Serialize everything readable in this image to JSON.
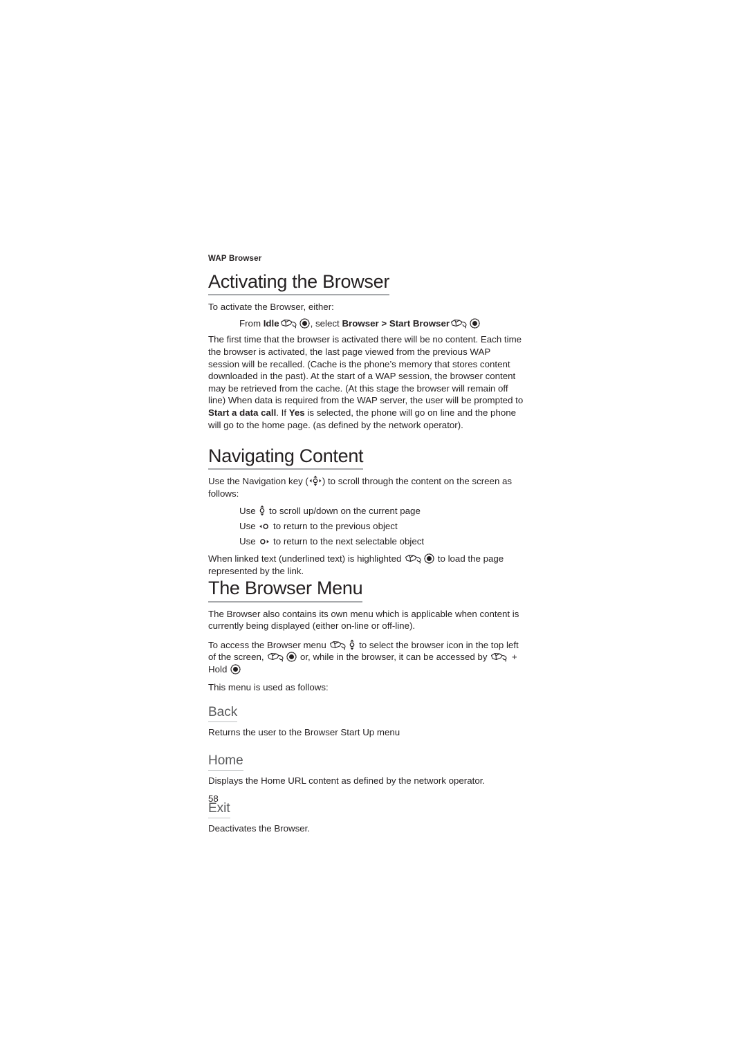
{
  "page": {
    "running_head": "WAP Browser",
    "folio": "58",
    "accent_rule_color": "#a7a9ac",
    "heading_color": "#231f20",
    "subheading_color": "#58595b",
    "body_color": "#231f20",
    "background": "#ffffff"
  },
  "icons": {
    "hand": "hand-icon",
    "ok": "select-key-icon",
    "up_down": "up-down-navigation-key-icon",
    "nav_key": "navigation-key-icon",
    "left": "left-navigation-key-icon",
    "right": "right-navigation-key-icon"
  },
  "sections": {
    "activating": {
      "title": "Activating the Browser",
      "intro": "To activate the Browser, either:",
      "step_prefix": "From ",
      "step_idle": "Idle",
      "step_mid": ", select ",
      "step_browser": "Browser",
      "step_gt": " > ",
      "step_start_browser": "Start Browser",
      "paragraph": "The first time that the browser is activated there will be no content.  Each time the browser is activated, the last page viewed from the previous WAP session will be recalled. (Cache is the phone’s memory that stores content downloaded in the past). At the start of a WAP session, the browser content may be retrieved from the cache. (At this stage the browser will remain off line) When data is required from the WAP server, the user will be prompted to ",
      "paragraph_bold_1": "Start a data call",
      "paragraph_mid": ". If ",
      "paragraph_bold_2": "Yes",
      "paragraph_end": " is selected, the phone will go on line and the phone will go to the home page. (as defined by the network operator)."
    },
    "navigating": {
      "title": "Navigating Content",
      "intro_before": "Use the Navigation key (",
      "intro_after": ") to scroll through the content on the screen as follows:",
      "bullets": [
        {
          "prefix": "Use ",
          "suffix": " to scroll up/down on the current page",
          "icon": "up-down-navigation-key-icon"
        },
        {
          "prefix": "Use ",
          "suffix": " to return to the previous object",
          "icon": "left-navigation-key-icon"
        },
        {
          "prefix": "Use ",
          "suffix": " to return to the next selectable object",
          "icon": "right-navigation-key-icon"
        }
      ],
      "linked_before": "When linked text (underlined text) is highlighted ",
      "linked_after": " to load the page represented by the link."
    },
    "browser_menu": {
      "title": "The Browser Menu",
      "paragraph": "The Browser also contains its own menu which is applicable when content is currently being displayed (either on-line or off-line).",
      "access_1": "To access the Browser menu ",
      "access_2": " to select the browser icon in the top left of the screen, ",
      "access_3": " or, while in the browser, it can be accessed by ",
      "access_4": " + Hold ",
      "used_as_follows": "This menu is used as follows:",
      "items": [
        {
          "title": "Back",
          "body": "Returns the user to the Browser Start Up menu"
        },
        {
          "title": "Home",
          "body": "Displays the Home URL content as defined by the network operator."
        },
        {
          "title": "Exit",
          "body": "Deactivates the Browser."
        }
      ]
    }
  }
}
